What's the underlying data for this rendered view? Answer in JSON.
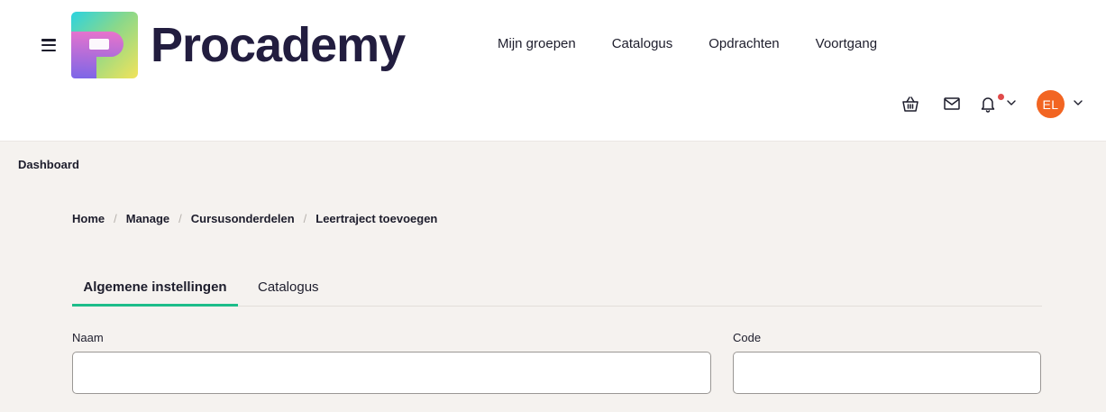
{
  "header": {
    "brand": "Procademy",
    "nav": [
      "Mijn groepen",
      "Catalogus",
      "Opdrachten",
      "Voortgang"
    ],
    "user_initials": "EL",
    "colors": {
      "accent": "#1dbd8a",
      "avatar": "#f26522",
      "notification_dot": "#e04a4a",
      "brand_text": "#221d3f"
    }
  },
  "page": {
    "heading": "Dashboard"
  },
  "breadcrumb": [
    "Home",
    "Manage",
    "Cursusonderdelen",
    "Leertraject toevoegen"
  ],
  "tabs": [
    "Algemene instellingen",
    "Catalogus"
  ],
  "form": {
    "name_label": "Naam",
    "name_value": "",
    "code_label": "Code",
    "code_value": ""
  }
}
